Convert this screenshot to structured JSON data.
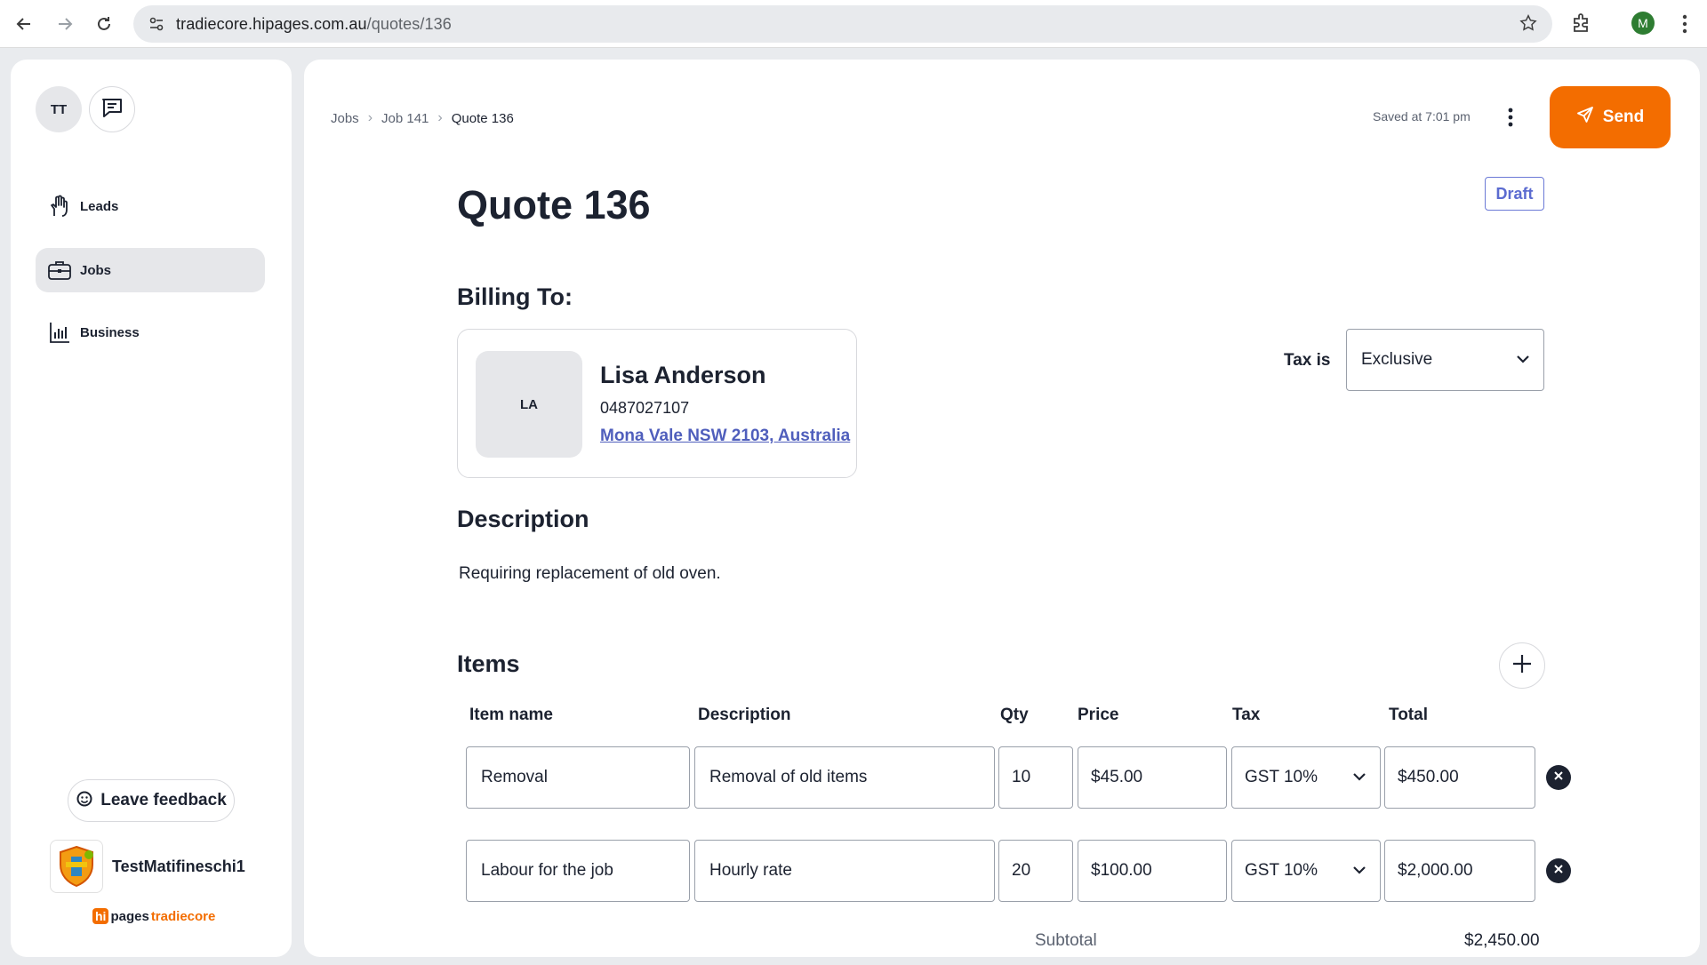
{
  "browser": {
    "url_host": "tradiecore.hipages.com.au",
    "url_path": "/quotes/136",
    "profile_initial": "M"
  },
  "sidebar": {
    "user_initials": "TT",
    "items": [
      {
        "label": "Leads",
        "icon": "hand-icon"
      },
      {
        "label": "Jobs",
        "icon": "briefcase-icon",
        "active": true
      },
      {
        "label": "Business",
        "icon": "bar-chart-icon"
      }
    ],
    "feedback_label": "Leave feedback",
    "business_name": "TestMatifineschi1",
    "brand": {
      "hi": "hi",
      "pages": "pages",
      "tradiecore": "tradiecore"
    }
  },
  "header": {
    "breadcrumb": [
      "Jobs",
      "Job 141",
      "Quote 136"
    ],
    "saved_text": "Saved at 7:01 pm",
    "send_label": "Send"
  },
  "quote": {
    "title": "Quote 136",
    "status": "Draft",
    "billing_heading": "Billing To:",
    "customer": {
      "initials": "LA",
      "name": "Lisa Anderson",
      "phone": "0487027107",
      "address": "Mona Vale NSW 2103, Australia"
    },
    "tax_label": "Tax is",
    "tax_mode": "Exclusive",
    "description_heading": "Description",
    "description": "Requiring replacement of old oven.",
    "items_heading": "Items",
    "columns": [
      "Item name",
      "Description",
      "Qty",
      "Price",
      "Tax",
      "Total"
    ],
    "items": [
      {
        "name": "Removal",
        "description": "Removal of old items",
        "qty": "10",
        "price": "$45.00",
        "tax": "GST 10%",
        "total": "$450.00"
      },
      {
        "name": "Labour for the job",
        "description": "Hourly rate",
        "qty": "20",
        "price": "$100.00",
        "tax": "GST 10%",
        "total": "$2,000.00"
      }
    ],
    "subtotal_label": "Subtotal",
    "subtotal": "$2,450.00"
  },
  "colors": {
    "accent": "#f36d00",
    "link": "#4f5ebc",
    "draft": "#5b6bd0"
  }
}
